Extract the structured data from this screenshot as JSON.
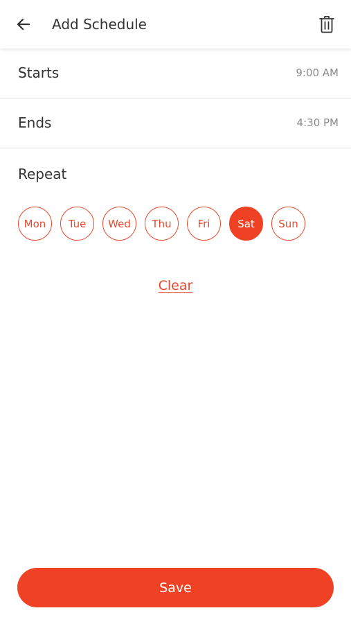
{
  "header": {
    "title": "Add Schedule",
    "back_icon": "arrow-left-icon",
    "delete_icon": "trash-icon"
  },
  "schedule": {
    "starts_label": "Starts",
    "starts_value": "9:00 AM",
    "ends_label": "Ends",
    "ends_value": "4:30 PM"
  },
  "repeat": {
    "label": "Repeat",
    "days": [
      {
        "label": "Mon",
        "selected": false
      },
      {
        "label": "Tue",
        "selected": false
      },
      {
        "label": "Wed",
        "selected": false
      },
      {
        "label": "Thu",
        "selected": false
      },
      {
        "label": "Fri",
        "selected": false
      },
      {
        "label": "Sat",
        "selected": true
      },
      {
        "label": "Sun",
        "selected": false
      }
    ]
  },
  "actions": {
    "clear_label": "Clear",
    "save_label": "Save"
  },
  "colors": {
    "accent": "#ef4123",
    "accent_outline": "#e64a2e",
    "text": "#333333",
    "muted_text": "#8a8a8a"
  }
}
